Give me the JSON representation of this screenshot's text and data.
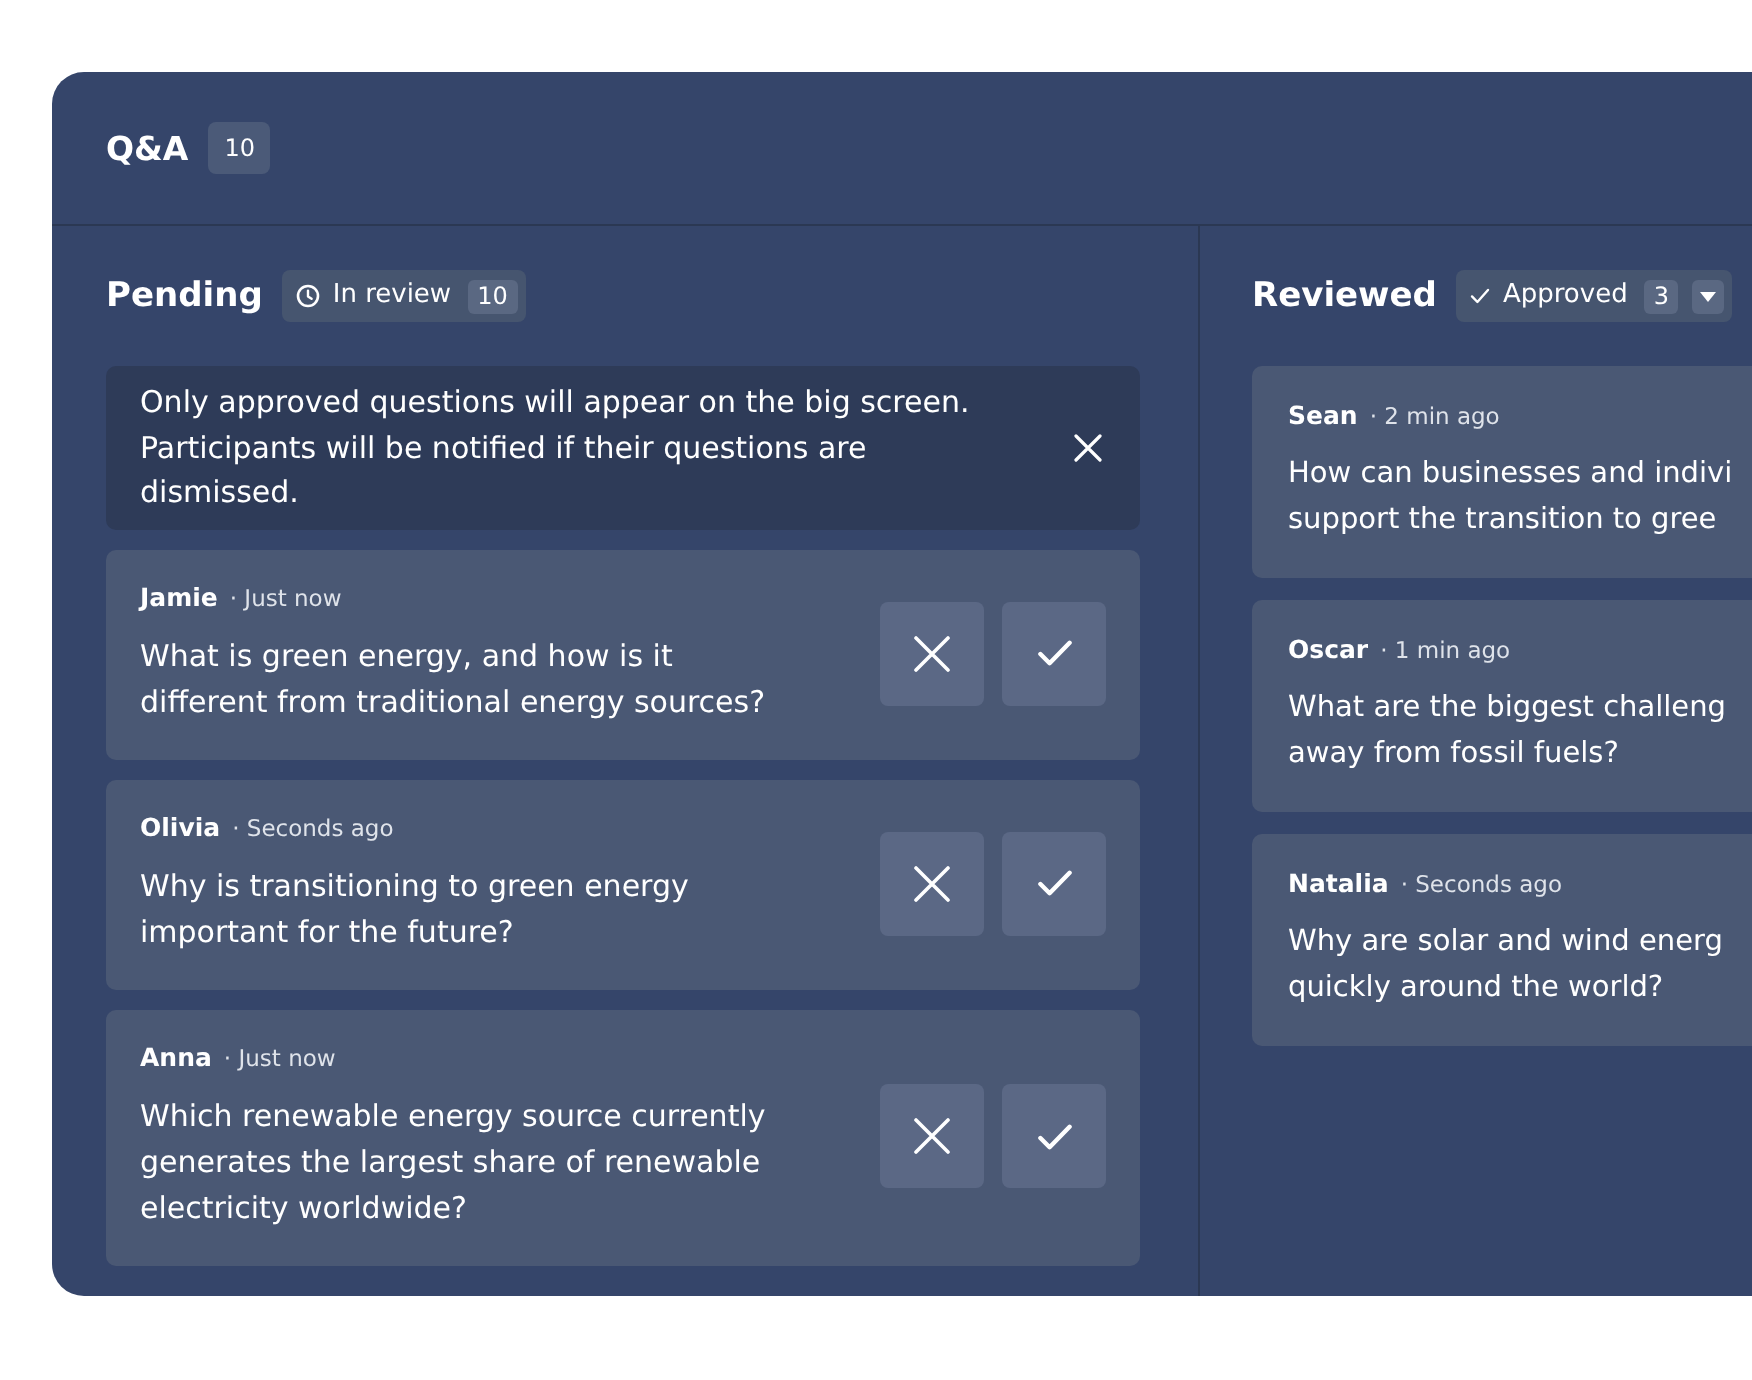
{
  "header": {
    "title": "Q&A",
    "count": "10"
  },
  "columns": [
    {
      "kind": "pending",
      "title": "Pending",
      "filter": {
        "label": "In review",
        "count": "10"
      },
      "notice": {
        "text": "Only approved questions will appear on the big screen. Participants will be notified if their questions are dismissed."
      },
      "questions": [
        {
          "author": "Jamie",
          "time": "· Just now",
          "question": "What is green energy, and how is it different from traditional energy sources?"
        },
        {
          "author": "Olivia",
          "time": "· Seconds ago",
          "question": "Why is transitioning to green energy important for the future?"
        },
        {
          "author": "Anna",
          "time": "· Just now",
          "question": "Which renewable energy source currently generates the largest share of renewable electricity worldwide?"
        }
      ]
    },
    {
      "kind": "reviewed",
      "title": "Reviewed",
      "filter": {
        "label": "Approved",
        "count": "3"
      },
      "questions": [
        {
          "author": "Sean",
          "time": "· 2 min ago",
          "lines": [
            "How can businesses and indivi",
            "support the transition to gree"
          ]
        },
        {
          "author": "Oscar",
          "time": "· 1 min ago",
          "lines": [
            "What are the biggest challeng",
            "away from fossil fuels?"
          ]
        },
        {
          "author": "Natalia",
          "time": "· Seconds ago",
          "lines": [
            "Why are solar and wind energ",
            "quickly around the world?"
          ]
        }
      ]
    }
  ]
}
